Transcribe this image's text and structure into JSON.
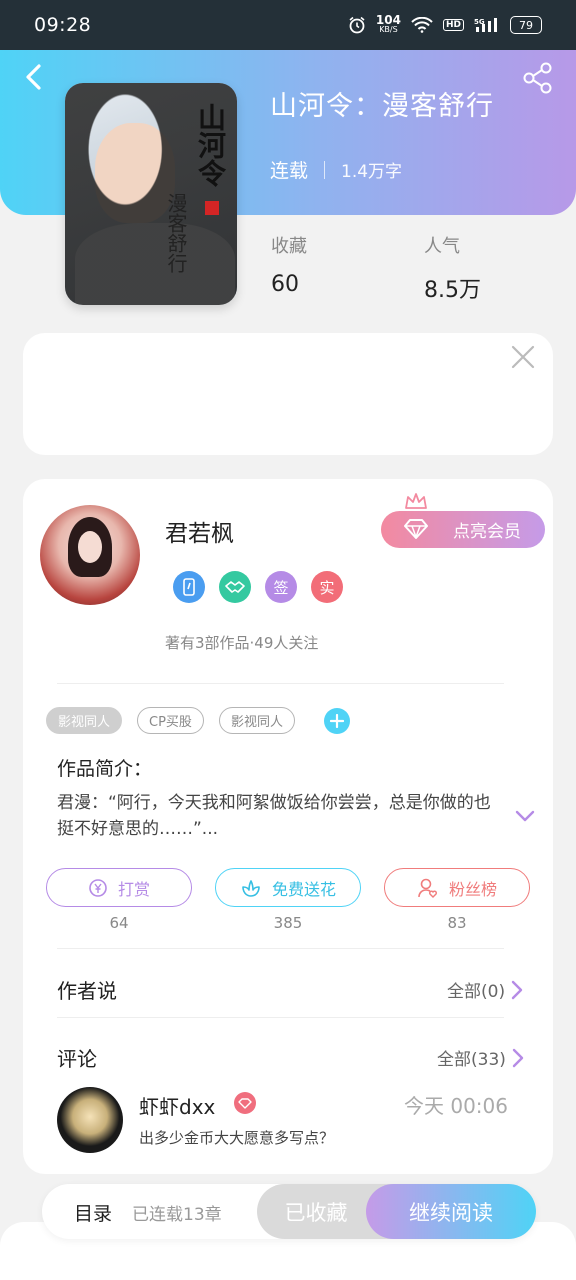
{
  "status_bar": {
    "time": "09:28",
    "net_speed": "104",
    "net_unit": "KB/S",
    "hd": "HD",
    "signal": "5G",
    "battery": "79"
  },
  "book": {
    "title": "山河令：漫客舒行",
    "status": "连载",
    "word_count": "1.4万字",
    "cover_text_main": "山河令",
    "cover_text_sub": "漫客舒行",
    "stats": [
      {
        "label": "收藏",
        "value": "60"
      },
      {
        "label": "人气",
        "value": "8.5万"
      }
    ]
  },
  "author": {
    "name": "君若枫",
    "vip_button": "点亮会员",
    "badges": [
      {
        "text": "",
        "icon": "phone-badge-icon",
        "color": "#4a9df0"
      },
      {
        "text": "",
        "icon": "handshake-badge-icon",
        "color": "#34c9a0"
      },
      {
        "text": "签",
        "icon": "sign-badge-icon",
        "color": "#b58be6"
      },
      {
        "text": "实",
        "icon": "verified-badge-icon",
        "color": "#f26d78"
      }
    ],
    "stats_text": "著有3部作品·49人关注"
  },
  "tags": [
    "影视同人",
    "CP买股",
    "影视同人"
  ],
  "intro": {
    "label": "作品简介：",
    "text": "君漫：“阿行，今天我和阿絮做饭给你尝尝，总是你做的也挺不好意思的……”..."
  },
  "actions": [
    {
      "label": "打赏",
      "count": "64",
      "color": "#b58be6",
      "icon": "yen-icon"
    },
    {
      "label": "免费送花",
      "count": "385",
      "color": "#4fd3f6",
      "icon": "flower-icon"
    },
    {
      "label": "粉丝榜",
      "count": "83",
      "color": "#f07c7c",
      "icon": "fan-icon"
    }
  ],
  "author_says": {
    "title": "作者说",
    "link": "全部(0)"
  },
  "comments": {
    "title": "评论",
    "link": "全部(33)",
    "items": [
      {
        "user": "虾虾dxx",
        "time": "今天 00:06",
        "text": "出多少金币大大愿意多写点？"
      }
    ]
  },
  "bottom": {
    "toc": "目录",
    "chapters": "已连载13章",
    "collected": "已收藏",
    "read": "继续阅读"
  },
  "colors": {
    "accent_start": "#4fd3f6",
    "accent_end": "#b799e8",
    "vip_pink": "#f38aa0"
  }
}
